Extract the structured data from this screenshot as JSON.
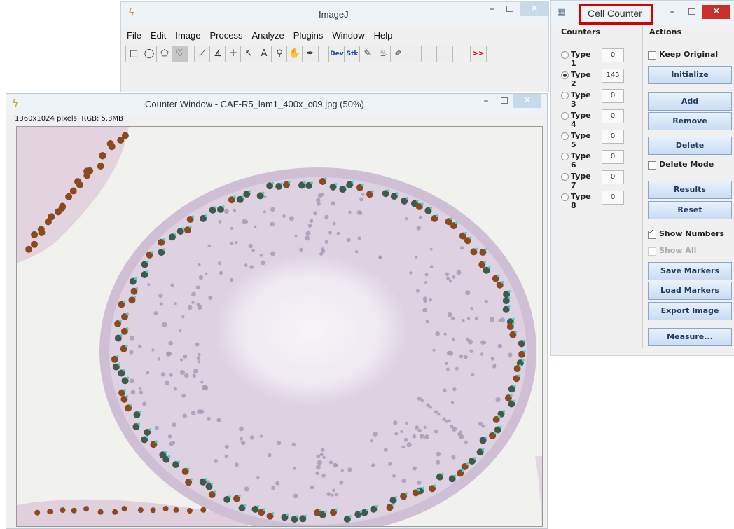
{
  "imagej": {
    "title": "ImageJ",
    "menu": [
      "File",
      "Edit",
      "Image",
      "Process",
      "Analyze",
      "Plugins",
      "Window",
      "Help"
    ],
    "tools": [
      {
        "icon": "rectangle-icon",
        "glyph": "□"
      },
      {
        "icon": "oval-icon",
        "glyph": "◯"
      },
      {
        "icon": "polygon-icon",
        "glyph": "⬠"
      },
      {
        "icon": "freehand-icon",
        "glyph": "♡",
        "selected": true
      },
      {
        "icon": "line-icon",
        "glyph": "⟋"
      },
      {
        "icon": "angle-icon",
        "glyph": "∡"
      },
      {
        "icon": "point-icon",
        "glyph": "✛"
      },
      {
        "icon": "wand-icon",
        "glyph": "↖"
      },
      {
        "icon": "text-icon",
        "glyph": "A"
      },
      {
        "icon": "magnifier-icon",
        "glyph": "⚲"
      },
      {
        "icon": "hand-icon",
        "glyph": "✋"
      },
      {
        "icon": "dropper-icon",
        "glyph": "✒"
      },
      {
        "icon": "dev-icon",
        "label": "Dev"
      },
      {
        "icon": "stk-icon",
        "label": "Stk"
      },
      {
        "icon": "brush-icon",
        "glyph": "✎"
      },
      {
        "icon": "flood-fill-icon",
        "glyph": "♨"
      },
      {
        "icon": "pencil-icon",
        "glyph": "✐"
      },
      {
        "icon": "more-tools-icon",
        "glyph": ">>"
      }
    ]
  },
  "counter_window": {
    "title": "Counter Window - CAF-R5_lam1_400x_c09.jpg (50%)",
    "info": "1360x1024 pixels; RGB; 5.3MB"
  },
  "cell_counter": {
    "title": "Cell Counter",
    "counters_header": "Counters",
    "actions_header": "Actions",
    "types": [
      {
        "label": "Type 1",
        "count": "0",
        "selected": false
      },
      {
        "label": "Type 2",
        "count": "145",
        "selected": true
      },
      {
        "label": "Type 3",
        "count": "0",
        "selected": false
      },
      {
        "label": "Type 4",
        "count": "0",
        "selected": false
      },
      {
        "label": "Type 5",
        "count": "0",
        "selected": false
      },
      {
        "label": "Type 6",
        "count": "0",
        "selected": false
      },
      {
        "label": "Type 7",
        "count": "0",
        "selected": false
      },
      {
        "label": "Type 8",
        "count": "0",
        "selected": false
      }
    ],
    "keep_original": "Keep Original",
    "initialize": "Initialize",
    "add": "Add",
    "remove": "Remove",
    "delete": "Delete",
    "delete_mode": "Delete Mode",
    "results": "Results",
    "reset": "Reset",
    "show_numbers": "Show Numbers",
    "show_all": "Show All",
    "save_markers": "Save Markers",
    "load_markers": "Load Markers",
    "export_image": "Export Image",
    "measure": "Measure..."
  },
  "colors": {
    "marker": "#3fd8c8",
    "tissue": "#d8cde0",
    "brown_nucleus": "#8a4a20",
    "highlight": "#d60000"
  }
}
